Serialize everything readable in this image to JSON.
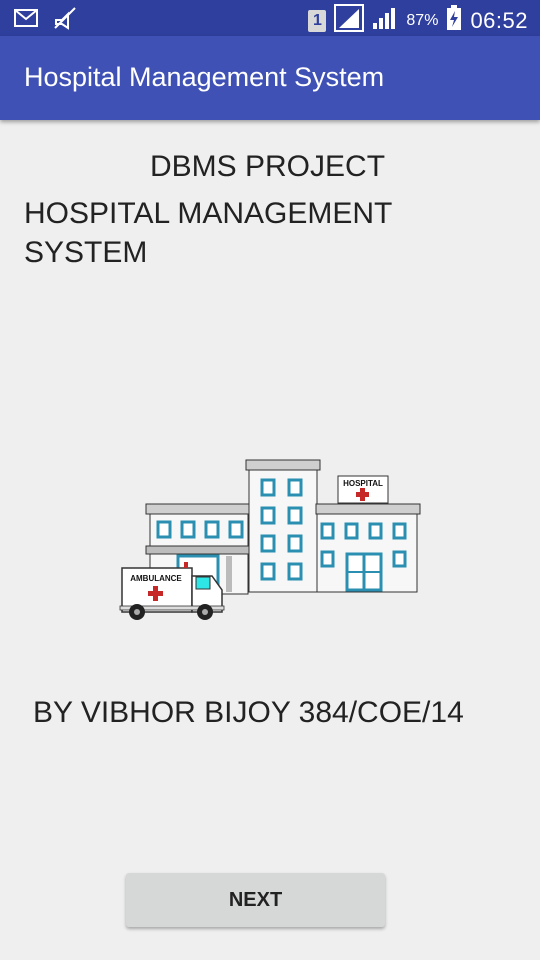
{
  "status_bar": {
    "sim_slot": "1",
    "battery_percent": "87%",
    "time": "06:52",
    "icons": [
      "mail-icon",
      "mute-icon",
      "sim-icon",
      "signal-icon",
      "signal-icon",
      "battery-charging-icon"
    ]
  },
  "app_bar": {
    "title": "Hospital Management System",
    "color": "#3f51b5"
  },
  "content": {
    "heading": "DBMS PROJECT",
    "subheading": "HOSPITAL MANAGEMENT SYSTEM",
    "illustration_hospital_label": "HOSPITAL",
    "illustration_ambulance_label": "AMBULANCE",
    "byline": "BY VIBHOR BIJOY 384/COE/14"
  },
  "actions": {
    "next_label": "NEXT"
  }
}
